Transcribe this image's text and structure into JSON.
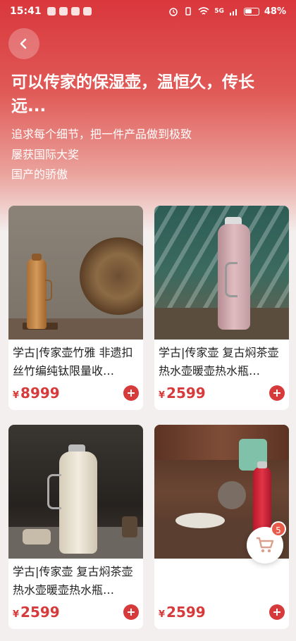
{
  "status_bar": {
    "time": "15:41",
    "network": "5G",
    "battery": "48%"
  },
  "header": {
    "headline": "可以传家的保湿壶，温恒久，传长远...",
    "subtitles": [
      "追求每个细节，把一件产品做到极致",
      "屡获国际大奖",
      "国产的骄傲"
    ]
  },
  "products": [
    {
      "title": "学古|传家壶竹雅 非遗扣丝竹编纯钛限量收…",
      "currency": "¥",
      "price": "8999"
    },
    {
      "title": "学古|传家壶 复古焖茶壶热水壶暖壶热水瓶…",
      "currency": "¥",
      "price": "2599"
    },
    {
      "title": "学古|传家壶 复古焖茶壶热水壶暖壶热水瓶…",
      "currency": "¥",
      "price": "2599"
    },
    {
      "title": "",
      "currency": "¥",
      "price": "2599"
    }
  ],
  "cart": {
    "count": "5"
  },
  "colors": {
    "accent": "#d63a3a",
    "hero_top": "#d9373c"
  },
  "icons": [
    "back-arrow-icon",
    "add-icon",
    "cart-icon"
  ]
}
